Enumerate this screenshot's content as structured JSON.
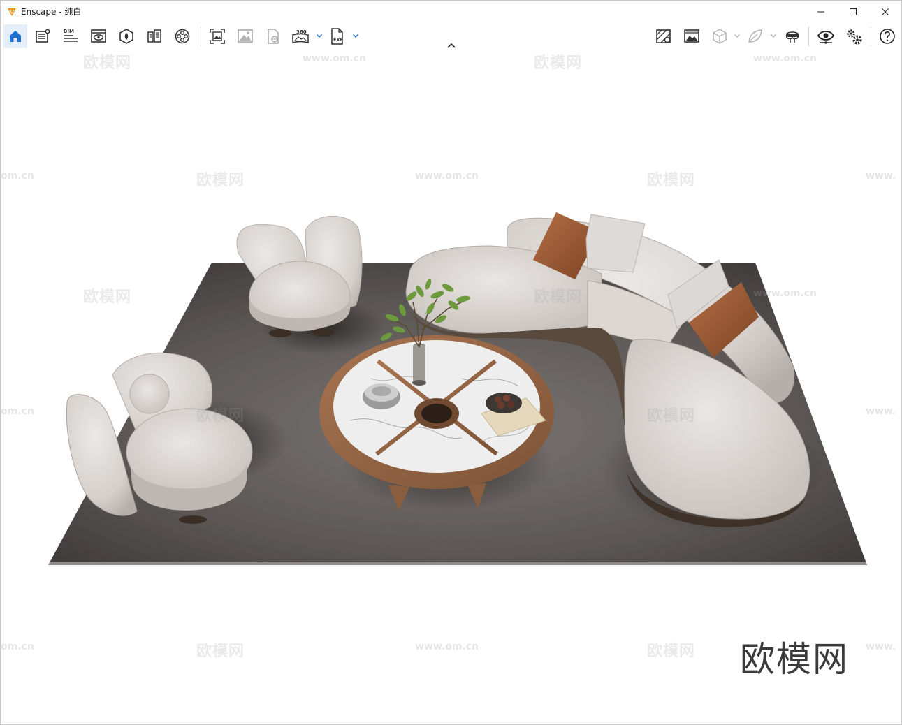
{
  "window": {
    "title": "Enscape - 纯白",
    "controls": [
      "minimize",
      "maximize",
      "close"
    ]
  },
  "toolbar": {
    "left_group": [
      {
        "name": "home-icon",
        "active": true
      },
      {
        "name": "notes-icon"
      },
      {
        "name": "bim-icon",
        "label": "BIM"
      },
      {
        "name": "view-icon"
      },
      {
        "name": "asset-library-icon"
      },
      {
        "name": "sun-study-icon"
      },
      {
        "name": "video-editor-icon"
      }
    ],
    "export_group": [
      {
        "name": "screenshot-icon"
      },
      {
        "name": "batch-render-icon"
      },
      {
        "name": "web-export-icon"
      },
      {
        "name": "panorama-icon",
        "label": "360",
        "has_dropdown": true
      },
      {
        "name": "exe-export-icon",
        "label": "EXE",
        "has_dropdown": true
      }
    ],
    "right_group": [
      {
        "name": "upload-map-icon"
      },
      {
        "name": "visual-settings-icon"
      },
      {
        "name": "cube-icon",
        "has_dropdown": true,
        "disabled": true
      },
      {
        "name": "material-leaf-icon",
        "has_dropdown": true,
        "disabled": true
      },
      {
        "name": "vr-headset-icon"
      },
      {
        "name": "eye-settings-icon"
      },
      {
        "name": "gear-settings-icon"
      },
      {
        "name": "help-icon"
      }
    ]
  },
  "viewport": {
    "watermark_text": "欧模网",
    "watermark_url": "www.om.cn",
    "watermark_url_partial": "om.cn",
    "watermark_url_prefix": "www.",
    "brand_watermark": "欧模网"
  },
  "colors": {
    "accent": "#1e6fd0",
    "rug": "#5f5a58",
    "sofa": "#d7d2ce",
    "pillow_leather": "#9a5a36",
    "table_wood": "#9a6a48",
    "marble": "#ececec"
  }
}
